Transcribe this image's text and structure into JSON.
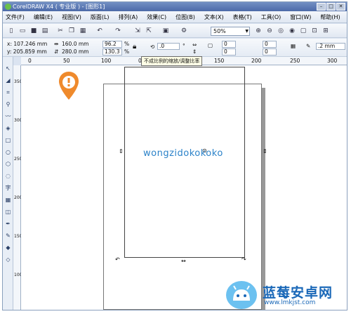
{
  "window": {
    "title": "CorelDRAW X4 ( 专业版 ) - [图形1]"
  },
  "menu": [
    "文件(F)",
    "编辑(E)",
    "视图(V)",
    "版面(L)",
    "排列(A)",
    "效果(C)",
    "位图(B)",
    "文本(X)",
    "表格(T)",
    "工具(O)",
    "窗口(W)",
    "帮助(H)"
  ],
  "toolbar": {
    "zoom": "50%"
  },
  "props": {
    "x": "x: 107.246 mm",
    "y": "y: 205.859 mm",
    "width": "160.0 mm",
    "height": "280.0 mm",
    "scale_x": "96.2",
    "scale_y": "130.3",
    "pct1": "%",
    "pct2": "%",
    "rotate": ".0",
    "deg": "°",
    "a": "0",
    "b": "0",
    "c": "0",
    "d": "0",
    "pen": ".2 mm"
  },
  "tooltip": "不成比例的缩放/调整比率",
  "ruler_h": [
    "0",
    "50",
    "100",
    "0",
    "150",
    "200",
    "250",
    "300"
  ],
  "ruler_v": [
    "350",
    "300",
    "250",
    "200",
    "150",
    "100"
  ],
  "logo_text": "wongzidokokoko",
  "watermark": {
    "title": "蓝莓安卓网",
    "url": "www.lmkjst.com"
  }
}
